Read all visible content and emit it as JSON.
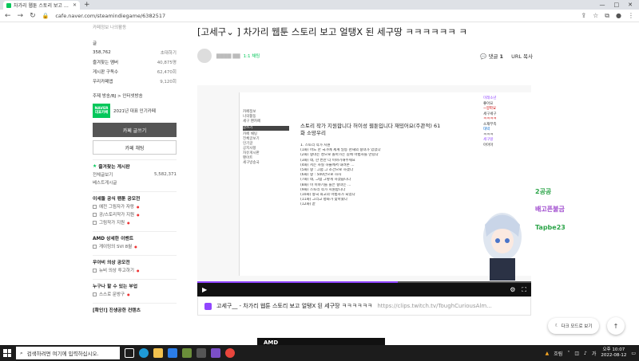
{
  "browser": {
    "tab_title": "차가리 웹툰 스토리 보고 얼탱X ...",
    "address": "cafe.naver.com/steamindiegame/6382517",
    "window_controls": [
      "—",
      "□",
      "✕"
    ]
  },
  "sidebar": {
    "top_links": "카페정보  나의활동",
    "member_label": "글",
    "stats": [
      {
        "label": "358,762",
        "value": "초대하기"
      },
      {
        "label": "즐겨찾는 멤버",
        "value": "40,875명"
      },
      {
        "label": "게시판 구독수",
        "value": "62,470회"
      },
      {
        "label": "우리카페앱",
        "value": "9,120회"
      }
    ],
    "theme_line": "주제 방송/BJ > 인터넷방송",
    "badge_text": "NAVER 대표카페",
    "badge_caption": "2021년 대표 인기카페",
    "join_button": "카페 글쓰기",
    "chat_button": "카페 채팅",
    "fav_section": "즐겨찾는 게시판",
    "all_posts": {
      "label": "전체글보기",
      "count": "5,582,371"
    },
    "best_posts": "베스트게시글",
    "section2": "이세돌 공식 팬툰 공모전",
    "section2_items": [
      "예전 그림자가 자랑",
      "공/스토리작가 지원",
      "그림작가 지원"
    ],
    "section3": "AMD 상세한 이벤트",
    "section3_items": [
      "게이밍의 SVI 8월"
    ],
    "section4": "우아비 의상 공모전",
    "section4_items": [
      "뉴비 의상 투고하기"
    ],
    "section5": "누구나 할 수 있는 부업",
    "section5_items": [
      "스스로 문방구"
    ],
    "section6": "[확인!] 진생공한 컨텐츠"
  },
  "post": {
    "title": "[고세구⌄ ] 차가리 웹툰 스토리 보고 얼탱X 된 세구땅 ㅋㅋㅋㅋㅋㅋ ㅋ",
    "author_grade": "1:1 채팅",
    "comments_label": "댓글",
    "comments_count": "1",
    "url_copy": "URL 복사",
    "clip_title": "고세구__ - 차가리 웹툰 스토리 보고 얼탱X 된 세구땅 ㅋㅋㅋㅋㅋㅋ",
    "clip_url": "https://clips.twitch.tv/ToughCuriousAlm..."
  },
  "video": {
    "progress": 0.6,
    "inner_title": "스토리 작가 지원합니다 허이성 웹툰입니다 재밌어요(주관적) 61화 소망우리",
    "inner_lines": [
      "1. 스토리 작가 지원",
      "(1화) 어느 한 국가에 세계 일등 천재의 왕녀가 있었다",
      "(2화) 왕녀는 성으로 돌아가는 길에 마법사를 만났다",
      "(3화) 네, 한 번만 더 이야기해주세요",
      "(4화) 저는 사실 하늘에서 내려온 ...",
      "(5화) 왕 : 그럼 그 조건으로 하겠다",
      "(6화) 왕 : 500만으로 하자",
      "(7화) 네, 그럼 그렇게 하겠습니다",
      "(8화) 이 이야기를 들은 왕녀는 ...",
      "(9화) 스토리 작가 지원합니다",
      "(10화) 왕국 최고의 마법사가 되었다",
      "(11화) 그리고 평화가 찾아왔다",
      "(12화) 끝"
    ],
    "inner_side": [
      "카페정보",
      "나의활동",
      "세구 팬카페",
      "글쓰기",
      "카페 채팅",
      "전체글보기",
      "인기글",
      "공지사항",
      "자유게시판",
      "팬아트",
      "세구방송국"
    ],
    "chat": [
      "미래소년",
      "좋아요",
      "~양파요",
      "세구세구",
      "ㅋㅋㅋㅋ",
      "소재부족",
      "대박",
      "ㅋㅋㅋ",
      "세구땅",
      "아아아"
    ],
    "controls": [
      "▶",
      "⚙",
      "⛶"
    ]
  },
  "overlay": {
    "text1": "2공공",
    "text2": "배고픈불금",
    "text3": "Tapbe23"
  },
  "dark_mode": "다크 모드로 보기",
  "ad_text": "AMD",
  "taskbar": {
    "search_placeholder": "검색하려면 여기에 입력하십시오.",
    "time": "오후 10:07",
    "date": "2022-08-12",
    "tray_text": "흐림"
  }
}
